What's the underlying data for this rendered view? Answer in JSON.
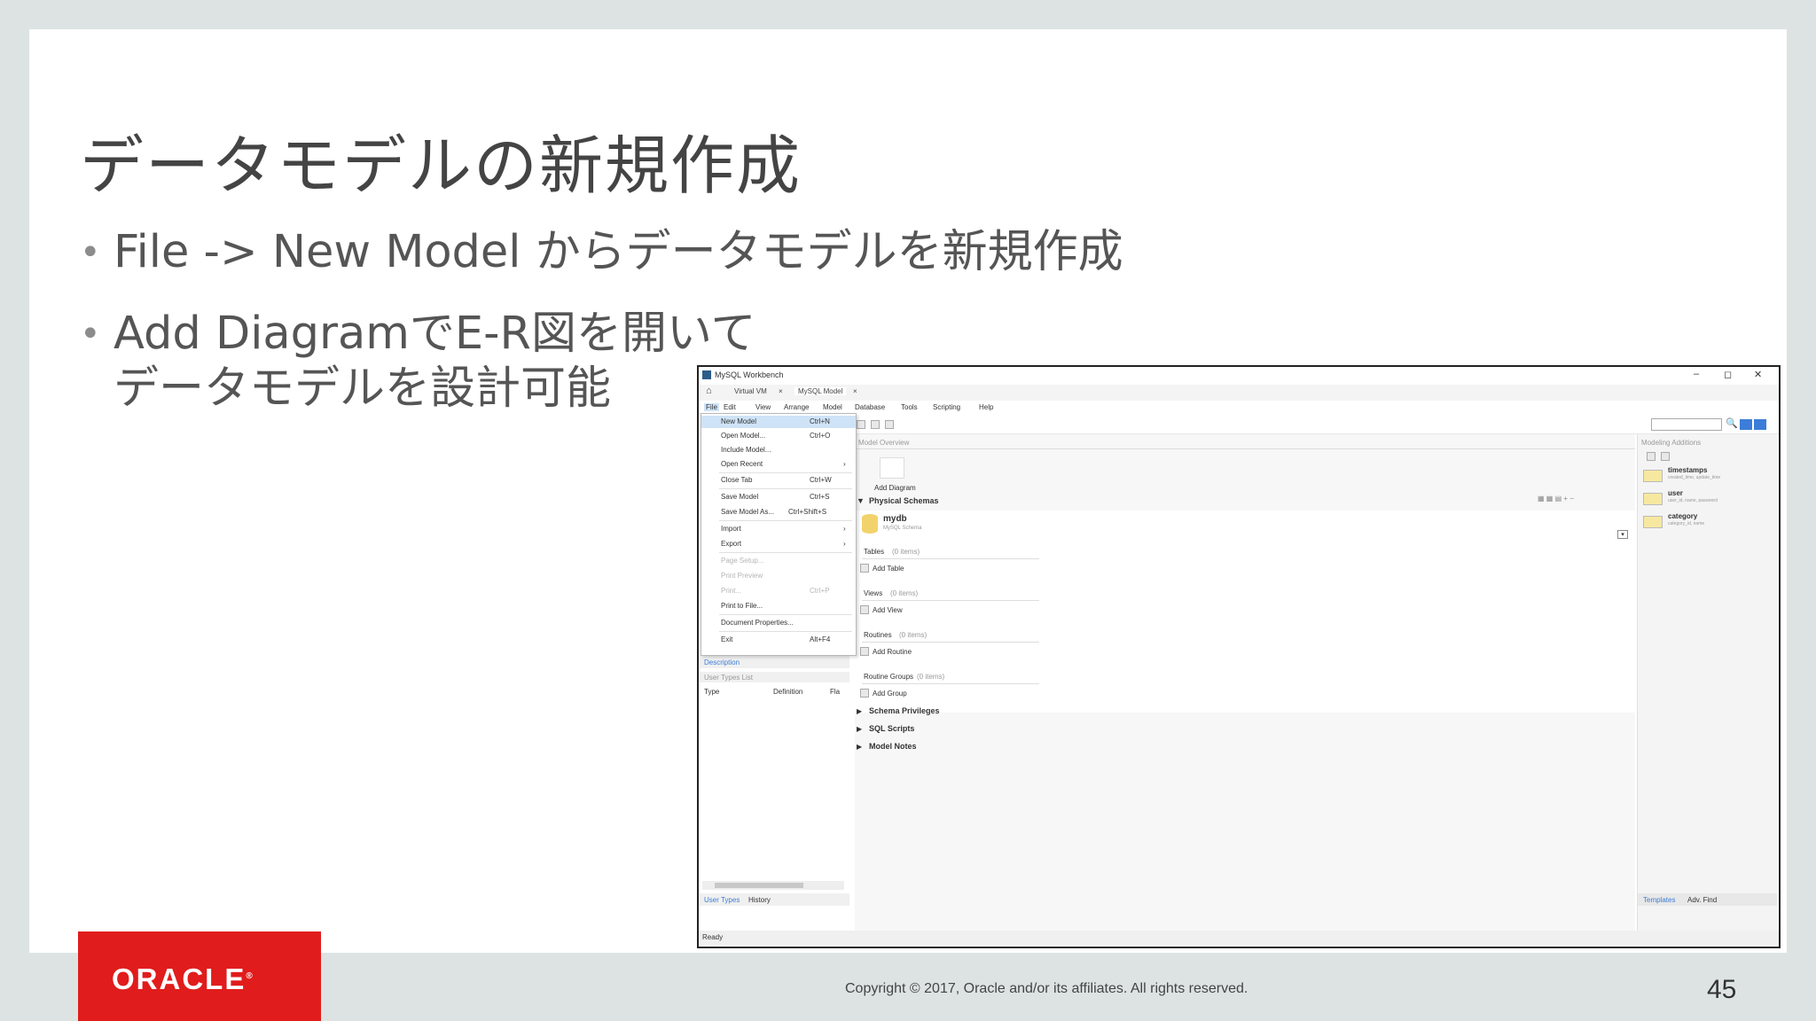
{
  "slide": {
    "title": "データモデルの新規作成",
    "bullets": [
      "File -> New Model からデータモデルを新規作成",
      "Add DiagramでE-R図を開いて",
      "データモデルを設計可能"
    ],
    "logo": "ORACLE",
    "copyright": "Copyright © 2017, Oracle and/or its affiliates. All rights reserved.",
    "page_number": "45"
  },
  "workbench": {
    "window_title": "MySQL Workbench",
    "window_controls": [
      "–",
      "◻",
      "✕"
    ],
    "tabs": [
      "Virtual VM",
      "MySQL Model"
    ],
    "menus": [
      "File",
      "Edit",
      "View",
      "Arrange",
      "Model",
      "Database",
      "Tools",
      "Scripting",
      "Help"
    ],
    "file_menu": [
      {
        "label": "New Model",
        "shortcut": "Ctrl+N",
        "state": "selected"
      },
      {
        "label": "Open Model...",
        "shortcut": "Ctrl+O",
        "state": "normal"
      },
      {
        "label": "Include Model...",
        "shortcut": "",
        "state": "normal"
      },
      {
        "label": "Open Recent",
        "shortcut": "›",
        "state": "normal"
      },
      {
        "label": "Close Tab",
        "shortcut": "Ctrl+W",
        "state": "normal"
      },
      {
        "label": "Save Model",
        "shortcut": "Ctrl+S",
        "state": "normal"
      },
      {
        "label": "Save Model As...",
        "shortcut": "Ctrl+Shift+S",
        "state": "normal"
      },
      {
        "label": "Import",
        "shortcut": "›",
        "state": "normal"
      },
      {
        "label": "Export",
        "shortcut": "›",
        "state": "normal"
      },
      {
        "label": "Page Setup...",
        "shortcut": "",
        "state": "disabled"
      },
      {
        "label": "Print Preview",
        "shortcut": "",
        "state": "disabled"
      },
      {
        "label": "Print...",
        "shortcut": "Ctrl+P",
        "state": "disabled"
      },
      {
        "label": "Print to File...",
        "shortcut": "",
        "state": "normal"
      },
      {
        "label": "Document Properties...",
        "shortcut": "",
        "state": "normal"
      },
      {
        "label": "Exit",
        "shortcut": "Alt+F4",
        "state": "normal"
      }
    ],
    "left_panel": {
      "description_tab": "Description",
      "user_types_header": "User Types List",
      "columns": [
        "Type",
        "Definition",
        "Fla"
      ],
      "bottom_tabs": [
        "User Types",
        "History"
      ]
    },
    "center": {
      "overview_header": "Model Overview",
      "add_diagram": "Add Diagram",
      "physical_schemas": "Physical Schemas",
      "schema_name": "mydb",
      "schema_sub": "MySQL Schema",
      "groups": [
        {
          "title": "Tables",
          "count": "(0 items)",
          "action": "Add Table"
        },
        {
          "title": "Views",
          "count": "(0 items)",
          "action": "Add View"
        },
        {
          "title": "Routines",
          "count": "(0 items)",
          "action": "Add Routine"
        },
        {
          "title": "Routine Groups",
          "count": "(0 items)",
          "action": "Add Group"
        }
      ],
      "collapsed_sections": [
        "Schema Privileges",
        "SQL Scripts",
        "Model Notes"
      ]
    },
    "right_panel": {
      "header": "Modeling Additions",
      "templates": [
        {
          "name": "timestamps",
          "desc": "created_time, update_time"
        },
        {
          "name": "user",
          "desc": "user_id, name, password"
        },
        {
          "name": "category",
          "desc": "category_id, name"
        }
      ],
      "bottom_tabs": [
        "Templates",
        "Adv. Find"
      ]
    },
    "status": "Ready"
  }
}
